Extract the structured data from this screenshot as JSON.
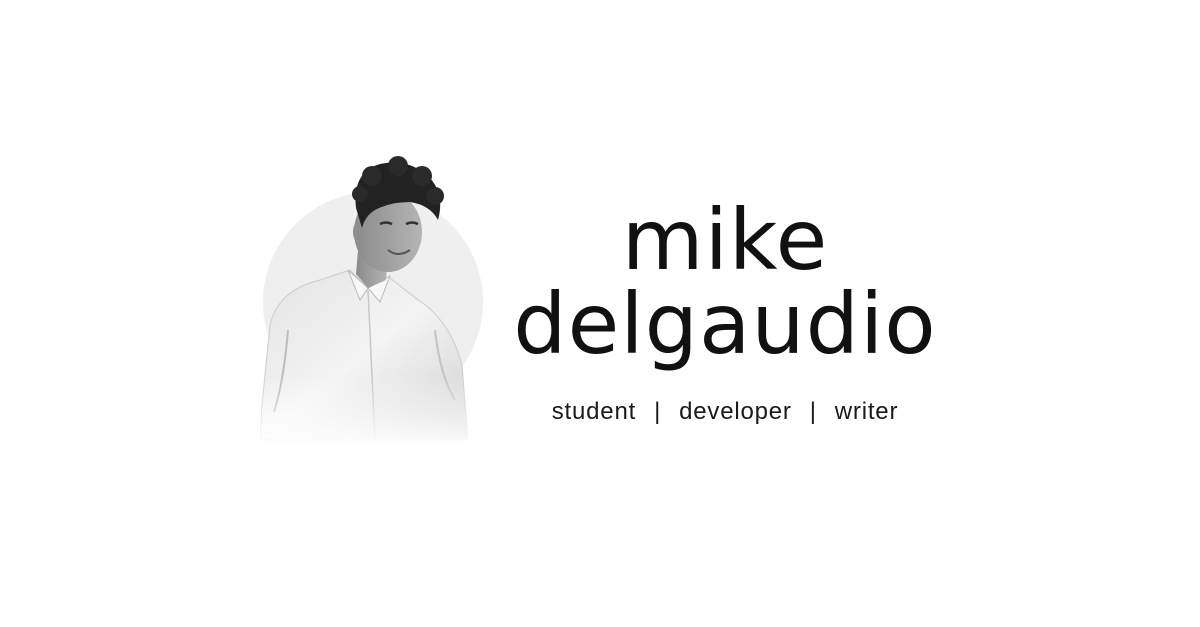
{
  "name": {
    "first": "mike",
    "last": "delgaudio"
  },
  "tagline": {
    "roles": [
      "student",
      "developer",
      "writer"
    ],
    "separator": "|"
  },
  "colors": {
    "background": "#ffffff",
    "text": "#111111",
    "portrait_circle": "#efefef"
  }
}
